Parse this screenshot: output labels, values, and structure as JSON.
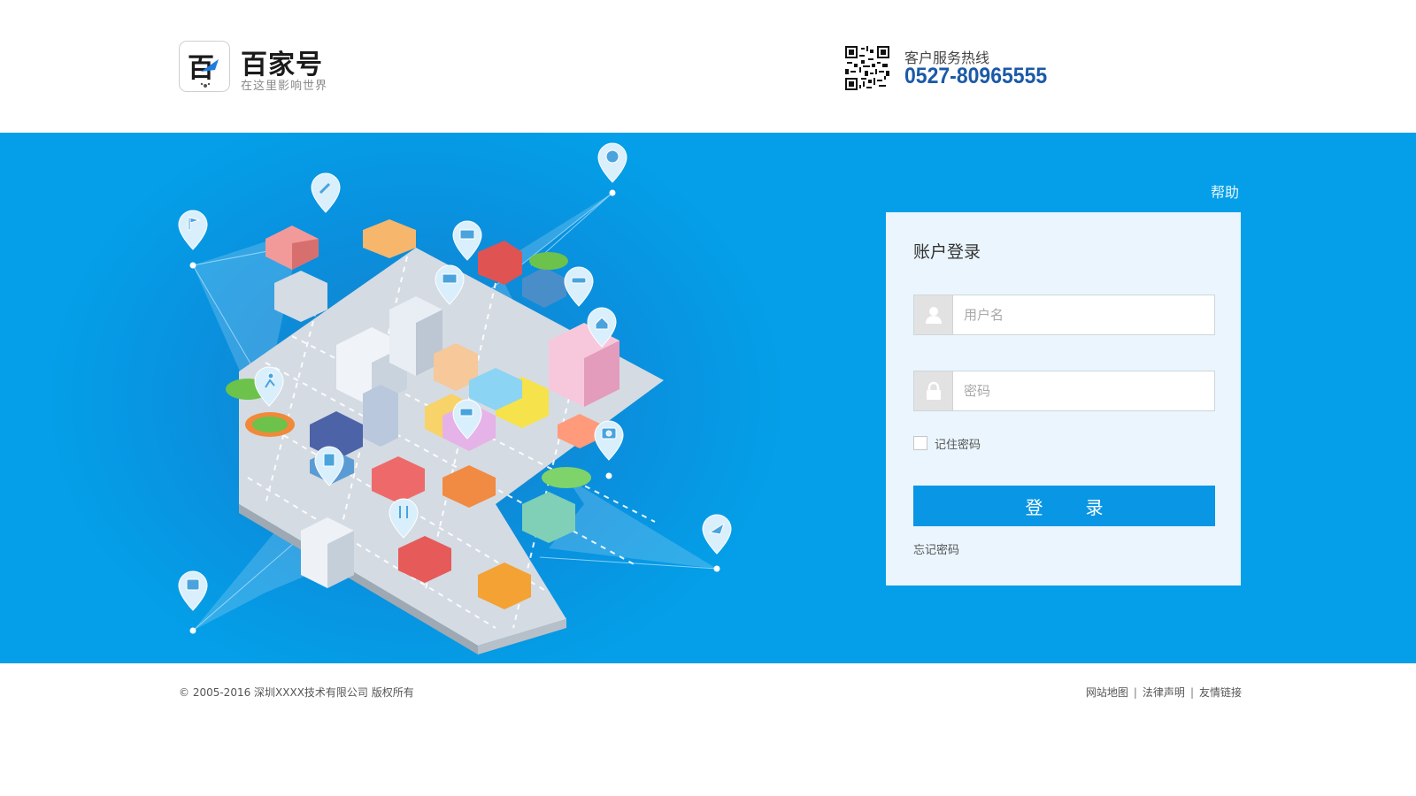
{
  "header": {
    "brand_name": "百家号",
    "brand_slogan": "在这里影响世界",
    "logo_letter": "百",
    "hotline_label": "客户服务热线",
    "hotline_number": "0527-80965555"
  },
  "login": {
    "help_label": "帮助",
    "title": "账户登录",
    "username_placeholder": "用户名",
    "username_value": "",
    "password_placeholder": "密码",
    "password_value": "",
    "remember_label": "记住密码",
    "remember_checked": false,
    "submit_label": "登录",
    "forgot_label": "忘记密码"
  },
  "footer": {
    "copyright": "© 2005-2016 深圳XXXX技术有限公司 版权所有",
    "links": [
      "网站地图",
      "法律声明",
      "友情链接"
    ]
  },
  "colors": {
    "banner_blue": "#049fe8",
    "button_blue": "#0996e4",
    "hotline_blue": "#1b5aa8",
    "card_bg": "#eaf5fd"
  },
  "icons": {
    "username": "user-icon",
    "password": "lock-icon",
    "map_pins": [
      "flag-icon",
      "wrench-icon",
      "book-icon",
      "smile-icon",
      "car-icon",
      "home-icon",
      "monitor-icon",
      "runner-icon",
      "cart-icon",
      "camera-icon",
      "building-icon",
      "utensils-icon",
      "airplane-icon",
      "bus-icon"
    ]
  }
}
